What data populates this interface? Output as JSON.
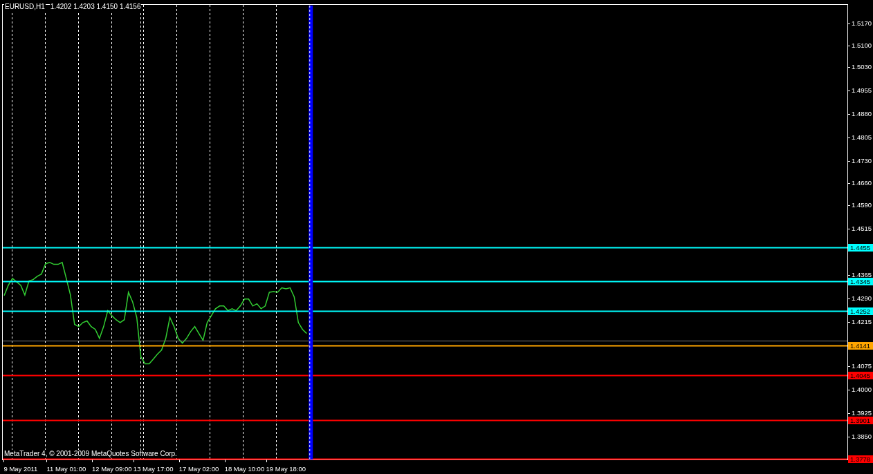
{
  "chart": {
    "symbol": "EURUSD,H1",
    "ohlc": [
      "1.4202",
      "1.4203",
      "1.4150",
      "1.4156"
    ],
    "copyright": "MetaTrader 4, © 2001-2009 MetaQuotes Software Corp.",
    "chart_data": {
      "type": "line",
      "grid": true,
      "ylim": [
        1.3776,
        1.5232
      ],
      "categories": [
        null,
        null,
        null,
        null,
        "9 May 2011",
        null,
        null,
        null,
        null,
        null,
        null,
        null,
        null,
        null,
        null,
        "11 May 01:00",
        null,
        null,
        null,
        null,
        null,
        null,
        null,
        null,
        null,
        null,
        "12 May 09:00",
        null,
        null,
        null,
        null,
        null,
        null,
        null,
        null,
        null,
        "13 May 17:00",
        null,
        null,
        null,
        null,
        null,
        null,
        null,
        null,
        null,
        null,
        "17 May 02:00",
        null,
        null,
        null,
        null,
        null,
        null,
        null,
        null,
        null,
        null,
        "18 May 10:00",
        null,
        null,
        null,
        null,
        null,
        null,
        null,
        null,
        null,
        "19 May 18:00",
        null,
        null,
        null,
        null,
        null,
        null,
        null,
        null,
        null,
        null,
        null,
        null,
        null,
        null,
        null,
        null,
        null,
        null,
        null,
        null,
        null,
        null,
        null,
        null,
        null,
        null,
        null,
        null,
        null,
        null,
        null,
        null,
        null,
        null,
        null,
        null,
        null,
        null,
        null,
        null,
        null,
        null,
        null,
        null,
        null,
        null,
        null,
        null,
        null,
        null,
        null,
        null,
        null,
        null,
        null,
        null,
        null,
        null,
        null,
        null,
        null,
        null,
        null,
        null,
        null,
        null,
        null,
        null,
        null,
        null,
        null,
        null,
        null,
        null,
        null,
        null,
        null,
        null,
        null,
        null,
        null,
        null,
        null,
        null,
        null,
        null,
        null,
        null,
        null,
        null,
        null,
        null,
        null,
        null,
        null,
        null,
        null,
        null,
        null,
        null,
        null,
        null,
        null,
        null,
        null,
        null,
        null,
        null,
        null,
        null,
        null,
        null,
        null,
        null,
        null,
        null,
        null,
        null,
        null,
        null,
        null,
        null,
        null,
        null,
        null,
        null,
        null,
        null,
        null,
        null,
        null,
        null,
        null,
        null,
        null
      ],
      "yticks": [
        {
          "value": 1.517,
          "label": "1.5170"
        },
        {
          "value": 1.51,
          "label": "1.5100"
        },
        {
          "value": 1.503,
          "label": "1.5030"
        },
        {
          "value": 1.4955,
          "label": "1.4955"
        },
        {
          "value": 1.488,
          "label": "1.4880"
        },
        {
          "value": 1.4805,
          "label": "1.4805"
        },
        {
          "value": 1.473,
          "label": "1.4730"
        },
        {
          "value": 1.466,
          "label": "1.4660"
        },
        {
          "value": 1.459,
          "label": "1.4590"
        },
        {
          "value": 1.4515,
          "label": "1.4515"
        },
        {
          "value": 1.4365,
          "label": "1.4365"
        },
        {
          "value": 1.429,
          "label": "1.4290"
        },
        {
          "value": 1.4215,
          "label": "1.4215"
        },
        {
          "value": 1.4075,
          "label": "1.4075"
        },
        {
          "value": 1.4,
          "label": "1.4000"
        },
        {
          "value": 1.3925,
          "label": "1.3925"
        },
        {
          "value": 1.385,
          "label": "1.3850"
        }
      ],
      "series": [
        {
          "color": "#32cd32",
          "values": [
            1.43,
            1.4333,
            1.4355,
            1.4344,
            1.4333,
            1.4302,
            1.4347,
            1.4351,
            1.4362,
            1.4369,
            1.4402,
            1.4406,
            1.44,
            1.44,
            1.4406,
            1.4355,
            1.4302,
            1.4208,
            1.4201,
            1.4214,
            1.4219,
            1.4201,
            1.4192,
            1.4163,
            1.4201,
            1.4252,
            1.4236,
            1.4223,
            1.4214,
            1.4223,
            1.4311,
            1.428,
            1.423,
            1.4104,
            1.4082,
            1.4082,
            1.4097,
            1.4113,
            1.4126,
            1.4163,
            1.423,
            1.4201,
            1.4163,
            1.4148,
            1.4163,
            1.4185,
            1.4201,
            1.4179,
            1.4157,
            1.4214,
            1.4236,
            1.4258,
            1.4267,
            1.4267,
            1.4252,
            1.4258,
            1.4252,
            1.4267,
            1.4289,
            1.4289,
            1.4267,
            1.4274,
            1.4258,
            1.4267,
            1.4311,
            1.4313,
            1.4311,
            1.4325,
            1.4322,
            1.4325,
            1.4296,
            1.4214,
            1.4192,
            1.4179,
            null,
            null,
            null,
            null,
            null,
            null,
            null,
            null,
            null,
            null,
            null,
            null,
            null,
            null,
            null,
            null,
            null,
            null,
            null,
            null,
            null,
            null,
            null,
            null,
            null,
            null,
            null,
            null,
            null,
            null,
            null,
            null,
            null,
            null,
            null,
            null,
            null,
            null,
            null,
            null,
            null,
            null,
            null,
            null,
            null,
            null,
            null,
            null,
            null,
            null,
            null,
            null,
            null,
            null,
            null,
            null,
            null,
            null,
            null,
            null,
            null,
            null,
            null,
            null,
            null,
            null,
            null,
            null,
            null,
            null,
            null,
            null,
            null,
            null,
            null,
            null,
            null,
            null,
            null,
            null,
            null,
            null,
            null,
            null,
            null,
            null,
            null,
            null,
            null,
            null,
            null,
            null,
            null,
            null,
            null,
            null,
            null,
            null,
            null,
            null,
            null,
            null,
            null,
            null,
            null,
            null,
            null,
            null,
            null,
            null,
            null,
            null,
            null,
            null,
            null,
            null,
            null,
            null,
            null,
            null,
            null,
            null,
            null,
            null,
            null,
            null,
            null,
            null,
            null,
            null
          ]
        }
      ],
      "ref_lines": [
        {
          "axis": "y",
          "value": 1.4455,
          "label": "1.4455",
          "color": "#00ffff"
        },
        {
          "axis": "y",
          "value": 1.4345,
          "label": "1.4345",
          "color": "#00ffff"
        },
        {
          "axis": "y",
          "value": 1.4252,
          "label": "1.4252",
          "color": "#00ffff"
        },
        {
          "axis": "y",
          "value": 1.4156,
          "color": "#808080"
        },
        {
          "axis": "y",
          "value": 1.4141,
          "label": "1.4141",
          "color": "#ffa500"
        },
        {
          "axis": "y",
          "value": 1.4045,
          "label": "1.4045",
          "color": "#ff0000"
        },
        {
          "axis": "y",
          "value": 1.3901,
          "label": "1.3901",
          "color": "#ff0000"
        },
        {
          "axis": "y",
          "value": 1.3778,
          "label": "1.3778",
          "color": "#ff0000"
        }
      ]
    }
  }
}
